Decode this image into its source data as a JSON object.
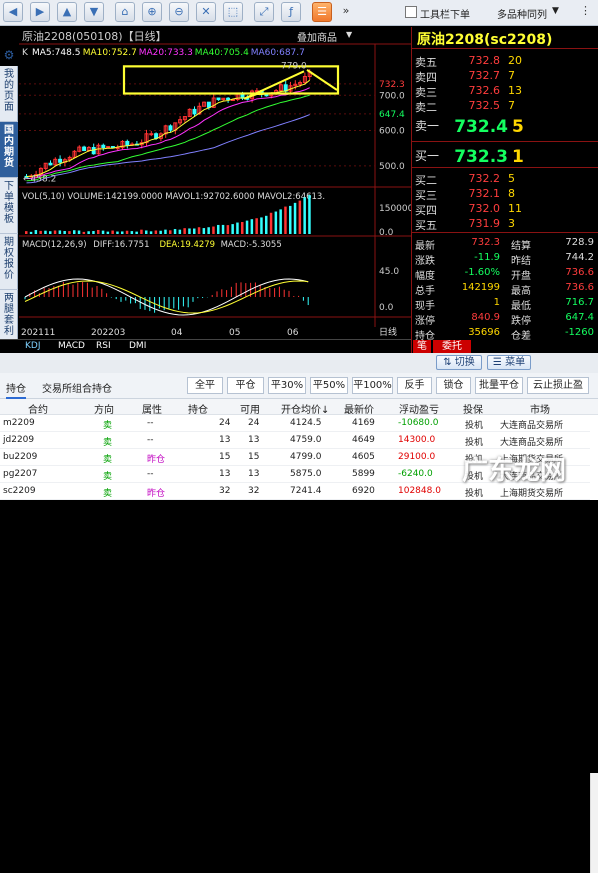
{
  "toolbar": {
    "buttons": [
      "arrow-left-icon",
      "arrow-right-icon",
      "up-arrow-icon",
      "down-arrow-icon",
      "home-icon",
      "expand-icon",
      "zoom-in-icon",
      "zoom-out-icon",
      "cross-icon",
      "select-icon",
      "formula-icon",
      "list-icon",
      "chevron-icon"
    ],
    "toolbar_check_label": "工具栏下单",
    "multi_label": "多品种同列"
  },
  "left_nav": {
    "items": [
      "我的页面",
      "国内期货",
      "下单模板",
      "期权报价",
      "两腿套利"
    ],
    "active": 1
  },
  "chart": {
    "title": "原油2208(050108)【日线】",
    "add_product_label": "叠加商品",
    "ma_prefix": "K",
    "ma_items": [
      {
        "label": "MA5:748.5",
        "color": "#ffffff"
      },
      {
        "label": "MA10:752.7",
        "color": "#ffff33"
      },
      {
        "label": "MA20:733.3",
        "color": "#ff33ff"
      },
      {
        "label": "MA40:705.4",
        "color": "#33ff33"
      },
      {
        "label": "MA60:687.7",
        "color": "#8080ff"
      }
    ],
    "price_ticks": [
      "732.3",
      "700.0",
      "647.4",
      "600.0",
      "500.0"
    ],
    "high_label": "779.0",
    "low_label": "458.2",
    "vol_header": "VOL(5,10) VOLUME:142199.0000 MAVOL1:92702.6000 MAVOL2:64613.",
    "vol_ticks": [
      "150000.",
      "0.0"
    ],
    "macd_header": {
      "name": "MACD(12,26,9)",
      "diff": "DIFF:16.7751",
      "dea": "DEA:19.4279",
      "macd": "MACD:-5.3055"
    },
    "macd_ticks": [
      "45.0",
      "0.0"
    ],
    "date_labels": [
      "202111",
      "202203",
      "04",
      "05",
      "06"
    ],
    "period": "日线",
    "bottom_tabs": [
      "KDJ",
      "MACD",
      "RSI",
      "DMI"
    ]
  },
  "chart_data": {
    "type": "candlestick",
    "price_axis": {
      "min": 440,
      "max": 800
    },
    "ma_values": {
      "MA5": 748.5,
      "MA10": 752.7,
      "MA20": 733.3,
      "MA40": 705.4,
      "MA60": 687.7
    },
    "close_high": 779.0,
    "close_low": 458.2,
    "volume": 142199,
    "mavol1": 92702.6,
    "mavol2": 64613,
    "macd": {
      "diff": 16.7751,
      "dea": 19.4279,
      "macd": -5.3055
    }
  },
  "quote": {
    "title": "原油2208(sc2208)",
    "asks": [
      {
        "label": "卖五",
        "price": "732.8",
        "vol": "20"
      },
      {
        "label": "卖四",
        "price": "732.7",
        "vol": "7"
      },
      {
        "label": "卖三",
        "price": "732.6",
        "vol": "13"
      },
      {
        "label": "卖二",
        "price": "732.5",
        "vol": "7"
      },
      {
        "label": "卖一",
        "price": "732.4",
        "vol": "5"
      }
    ],
    "bids": [
      {
        "label": "买一",
        "price": "732.3",
        "vol": "1"
      },
      {
        "label": "买二",
        "price": "732.2",
        "vol": "5"
      },
      {
        "label": "买三",
        "price": "732.1",
        "vol": "8"
      },
      {
        "label": "买四",
        "price": "732.0",
        "vol": "11"
      },
      {
        "label": "买五",
        "price": "731.9",
        "vol": "3"
      }
    ],
    "stats": [
      {
        "l1": "最新",
        "v1": "732.3",
        "c1": "#ff3d3d",
        "l2": "结算",
        "v2": "728.9",
        "c2": "#dddddd"
      },
      {
        "l1": "涨跌",
        "v1": "-11.9",
        "c1": "#14ff60",
        "l2": "昨结",
        "v2": "744.2",
        "c2": "#dddddd"
      },
      {
        "l1": "幅度",
        "v1": "-1.60%",
        "c1": "#14ff60",
        "l2": "开盘",
        "v2": "736.6",
        "c2": "#ff3d3d"
      },
      {
        "l1": "总手",
        "v1": "142199",
        "c1": "#ffd700",
        "l2": "最高",
        "v2": "736.6",
        "c2": "#ff3d3d"
      },
      {
        "l1": "现手",
        "v1": "1",
        "c1": "#ffd700",
        "l2": "最低",
        "v2": "716.7",
        "c2": "#14ff60"
      },
      {
        "l1": "涨停",
        "v1": "840.9",
        "c1": "#ff3d3d",
        "l2": "跌停",
        "v2": "647.4",
        "c2": "#14ff60"
      },
      {
        "l1": "持仓",
        "v1": "35696",
        "c1": "#ffd700",
        "l2": "仓差",
        "v2": "-1260",
        "c2": "#14ff60"
      }
    ],
    "tabs": [
      "笔",
      "委托"
    ]
  },
  "mid_bar": {
    "switch_label": "切换",
    "menu_label": "菜单"
  },
  "positions": {
    "tabs": [
      "持仓",
      "交易所组合持仓"
    ],
    "buttons": [
      "全平",
      "平仓",
      "平30%",
      "平50%",
      "平100%",
      "反手",
      "锁仓",
      "批量平仓",
      "云止损止盈"
    ],
    "columns": [
      "合约",
      "方向",
      "属性",
      "持仓",
      "可用",
      "开仓均价↓",
      "最新价",
      "浮动盈亏",
      "投保",
      "市场"
    ],
    "rows": [
      {
        "contract": "m2209",
        "dir": "卖",
        "attr": "--",
        "pos": "24",
        "avail": "24",
        "avg": "4124.5",
        "last": "4169",
        "pnl": "-10680.0",
        "hedge": "投机",
        "market": "大连商品交易所"
      },
      {
        "contract": "jd2209",
        "dir": "卖",
        "attr": "--",
        "pos": "13",
        "avail": "13",
        "avg": "4759.0",
        "last": "4649",
        "pnl": "14300.0",
        "hedge": "投机",
        "market": "大连商品交易所"
      },
      {
        "contract": "bu2209",
        "dir": "卖",
        "attr": "昨仓",
        "pos": "15",
        "avail": "15",
        "avg": "4799.0",
        "last": "4605",
        "pnl": "29100.0",
        "hedge": "投机",
        "market": "上海期货交易所"
      },
      {
        "contract": "pg2207",
        "dir": "卖",
        "attr": "--",
        "pos": "13",
        "avail": "13",
        "avg": "5875.0",
        "last": "5899",
        "pnl": "-6240.0",
        "hedge": "投机",
        "market": "大连商品交易所"
      },
      {
        "contract": "sc2209",
        "dir": "卖",
        "attr": "昨仓",
        "pos": "32",
        "avail": "32",
        "avg": "7241.4",
        "last": "6920",
        "pnl": "102848.0",
        "hedge": "投机",
        "market": "上海期货交易所"
      }
    ]
  },
  "watermark": "广东龙网"
}
